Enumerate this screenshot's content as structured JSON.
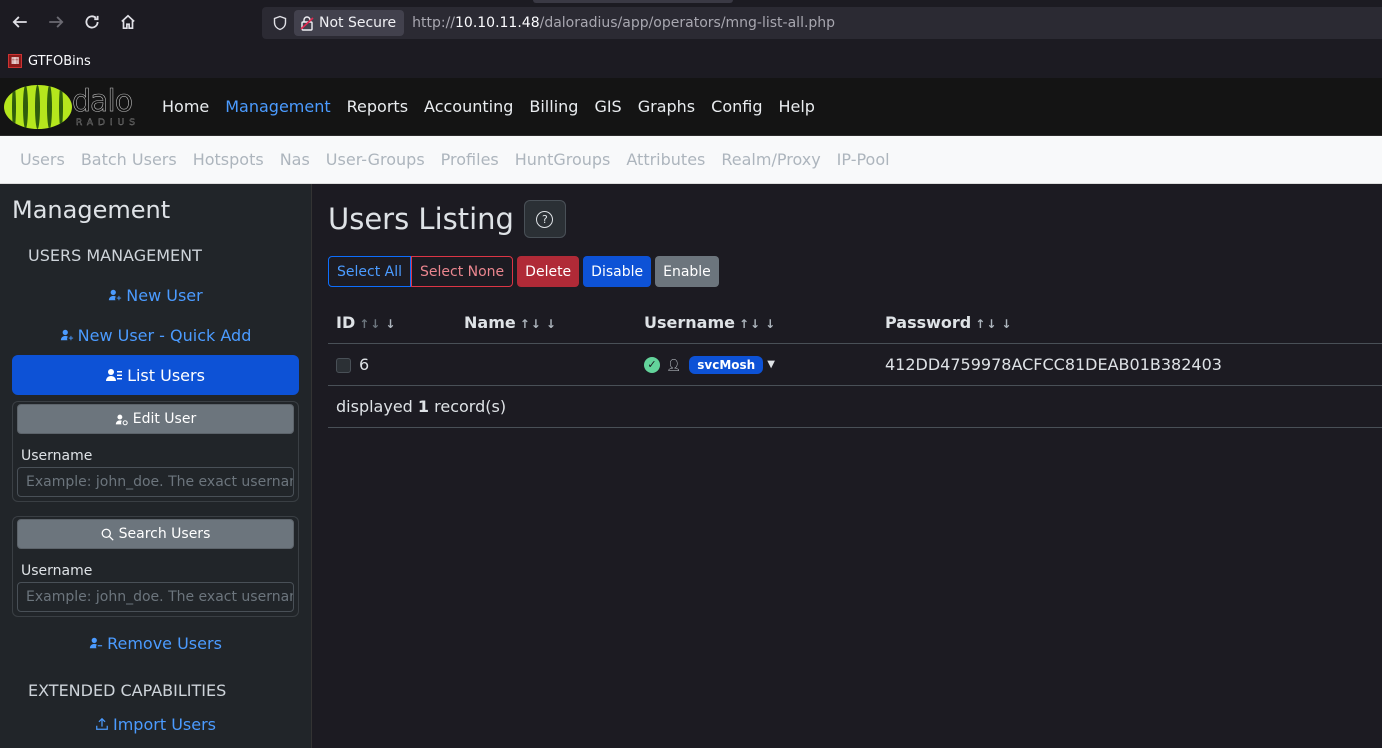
{
  "browser": {
    "security_label": "Not Secure",
    "url_prefix": "http://",
    "url_host": "10.10.11.48",
    "url_path": "/daloradius/app/operators/mng-list-all.php",
    "bookmark": "GTFOBins"
  },
  "logo": {
    "word": "dalo",
    "sub": "RADIUS"
  },
  "main_menu": [
    "Home",
    "Management",
    "Reports",
    "Accounting",
    "Billing",
    "GIS",
    "Graphs",
    "Config",
    "Help"
  ],
  "sub_menu": [
    "Users",
    "Batch Users",
    "Hotspots",
    "Nas",
    "User-Groups",
    "Profiles",
    "HuntGroups",
    "Attributes",
    "Realm/Proxy",
    "IP-Pool"
  ],
  "sidebar": {
    "title": "Management",
    "section1": "USERS MANAGEMENT",
    "new_user": "New User",
    "new_user_quick": "New User - Quick Add",
    "list_users": "List Users",
    "edit_user": "Edit User",
    "edit_label": "Username",
    "edit_placeholder": "Example: john_doe. The exact username",
    "search_users": "Search Users",
    "search_label": "Username",
    "search_placeholder": "Example: john_doe. The exact username",
    "remove_users": "Remove Users",
    "section2": "EXTENDED CAPABILITIES",
    "import_users": "Import Users"
  },
  "main": {
    "title": "Users Listing",
    "buttons": {
      "select_all": "Select All",
      "select_none": "Select None",
      "delete": "Delete",
      "disable": "Disable",
      "enable": "Enable"
    },
    "columns": [
      "ID",
      "Name",
      "Username",
      "Password"
    ],
    "rows": [
      {
        "id": "6",
        "name": "",
        "username": "svcMosh",
        "password": "412DD4759978ACFCC81DEAB01B382403"
      }
    ],
    "footer_prefix": "displayed",
    "footer_count": "1",
    "footer_suffix": "record(s)"
  },
  "colors": {
    "accent": "#0d52d6",
    "link": "#4b9bff",
    "danger": "#b02a37",
    "ok": "#63d39b"
  }
}
